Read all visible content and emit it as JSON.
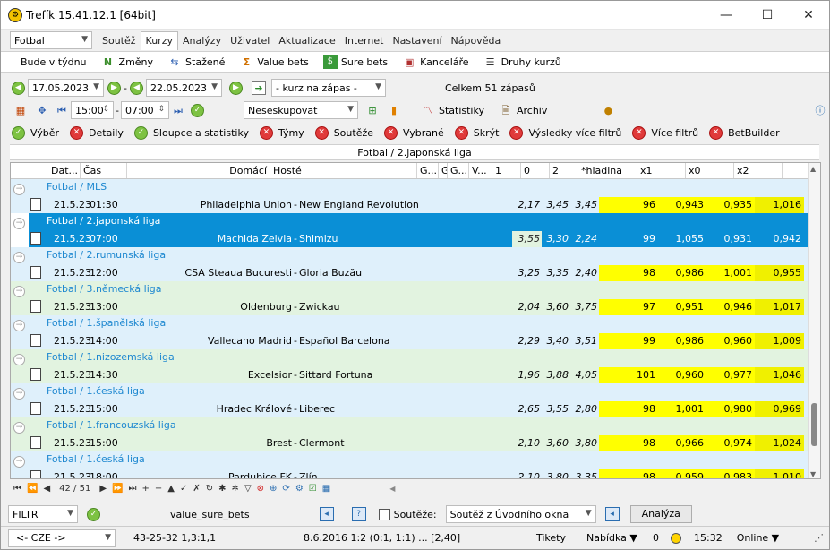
{
  "window": {
    "title": "Trefík 15.41.12.1 [64bit]",
    "minimize": "—",
    "maximize": "☐",
    "close": "✕"
  },
  "sport_select": "Fotbal",
  "menu": [
    "Soutěž",
    "Kurzy",
    "Analýzy",
    "Uživatel",
    "Aktualizace",
    "Internet",
    "Nastavení",
    "Nápověda"
  ],
  "active_menu": "Kurzy",
  "toolbar": {
    "period_button": "Bude v týdnu",
    "items": [
      "Změny",
      "Stažené",
      "Value bets",
      "Sure bets",
      "Kanceláře",
      "Druhy kurzů"
    ]
  },
  "filters": {
    "date_from": "17.05.2023",
    "date_to": "22.05.2023",
    "dash": "-",
    "odds_select": "- kurz na zápas -",
    "total": "Celkem 51 zápasů",
    "time_from": "15:00",
    "time_to": "07:00",
    "group_select": "Neseskupovat",
    "statistics": "Statistiky",
    "archive": "Archiv"
  },
  "filter_tabs": [
    {
      "label": "Výběr",
      "state": "ok"
    },
    {
      "label": "Detaily",
      "state": "off"
    },
    {
      "label": "Sloupce a statistiky",
      "state": "ok"
    },
    {
      "label": "Týmy",
      "state": "off"
    },
    {
      "label": "Soutěže",
      "state": "off"
    },
    {
      "label": "Vybrané",
      "state": "off"
    },
    {
      "label": "Skrýt",
      "state": "off"
    },
    {
      "label": "Výsledky více filtrů",
      "state": "off"
    },
    {
      "label": "Více filtrů",
      "state": "off"
    },
    {
      "label": "BetBuilder",
      "state": "off"
    }
  ],
  "grid": {
    "caption": "Fotbal / 2.japonská liga",
    "columns": [
      "Dat...",
      "Čas",
      "Domácí",
      "Hosté",
      "G...",
      "G...",
      "G...",
      "V...",
      "1",
      "0",
      "2",
      "*hladina",
      "x1",
      "x0",
      "x2"
    ],
    "rows": [
      {
        "league": "Fotbal / MLS",
        "date": "21.5.23",
        "time": "01:30",
        "home": "Philadelphia Union",
        "away": "New England Revolution",
        "o1": "2,17",
        "o0": "3,45",
        "o2": "3,45",
        "level": "96",
        "x1": "0,943",
        "x0": "0,935",
        "x2": "1,016",
        "bg": "#dff0fb"
      },
      {
        "league": "Fotbal / 2.japonská liga",
        "date": "21.5.23",
        "time": "07:00",
        "home": "Machida Zelvia",
        "away": "Shimizu",
        "o1": "3,55",
        "o0": "3,30",
        "o2": "2,24",
        "level": "99",
        "x1": "1,055",
        "x0": "0,931",
        "x2": "0,942",
        "bg": "#0a8fd6",
        "selected": true
      },
      {
        "league": "Fotbal / 2.rumunská liga",
        "date": "21.5.23",
        "time": "12:00",
        "home": "CSA Steaua Bucuresti",
        "away": "Gloria Buzău",
        "o1": "3,25",
        "o0": "3,35",
        "o2": "2,40",
        "level": "98",
        "x1": "0,986",
        "x0": "1,001",
        "x2": "0,955",
        "bg": "#dff0fb"
      },
      {
        "league": "Fotbal / 3.německá liga",
        "date": "21.5.23",
        "time": "13:00",
        "home": "Oldenburg",
        "away": "Zwickau",
        "o1": "2,04",
        "o0": "3,60",
        "o2": "3,75",
        "level": "97",
        "x1": "0,951",
        "x0": "0,946",
        "x2": "1,017",
        "bg": "#e2f3e0"
      },
      {
        "league": "Fotbal / 1.španělská liga",
        "date": "21.5.23",
        "time": "14:00",
        "home": "Vallecano Madrid",
        "away": "Español Barcelona",
        "o1": "2,29",
        "o0": "3,40",
        "o2": "3,51",
        "level": "99",
        "x1": "0,986",
        "x0": "0,960",
        "x2": "1,009",
        "bg": "#dff0fb"
      },
      {
        "league": "Fotbal / 1.nizozemská liga",
        "date": "21.5.23",
        "time": "14:30",
        "home": "Excelsior",
        "away": "Sittard Fortuna",
        "o1": "1,96",
        "o0": "3,88",
        "o2": "4,05",
        "level": "101",
        "x1": "0,960",
        "x0": "0,977",
        "x2": "1,046",
        "bg": "#e2f3e0"
      },
      {
        "league": "Fotbal / 1.česká liga",
        "date": "21.5.23",
        "time": "15:00",
        "home": "Hradec Králové",
        "away": "Liberec",
        "o1": "2,65",
        "o0": "3,55",
        "o2": "2,80",
        "level": "98",
        "x1": "1,001",
        "x0": "0,980",
        "x2": "0,969",
        "bg": "#dff0fb"
      },
      {
        "league": "Fotbal / 1.francouzská liga",
        "date": "21.5.23",
        "time": "15:00",
        "home": "Brest",
        "away": "Clermont",
        "o1": "2,10",
        "o0": "3,60",
        "o2": "3,80",
        "level": "98",
        "x1": "0,966",
        "x0": "0,974",
        "x2": "1,024",
        "bg": "#e2f3e0"
      },
      {
        "league": "Fotbal / 1.česká liga",
        "date": "21.5.23",
        "time": "18:00",
        "home": "Pardubice FK",
        "away": "Zlín",
        "o1": "2,10",
        "o0": "3,80",
        "o2": "3,35",
        "level": "98",
        "x1": "0,959",
        "x0": "0,983",
        "x2": "1,010",
        "bg": "#dff0fb"
      }
    ],
    "nav_position": "42 / 51"
  },
  "bottom_bar": {
    "filter_select": "FILTR",
    "filter_name": "value_sure_bets",
    "contest_label": "Soutěže:",
    "contest_select": "Soutěž z Úvodního okna",
    "analyze_button": "Analýza"
  },
  "status": {
    "lang": "<- CZE ->",
    "code": "43-25-32  1,3:1,1",
    "info": "8.6.2016 1:2 (0:1, 1:1) ... [2,40]",
    "tikety": "Tikety",
    "nabidka": "Nabídka ▼",
    "count": "0",
    "time": "15:32",
    "online": "Online ▼"
  }
}
